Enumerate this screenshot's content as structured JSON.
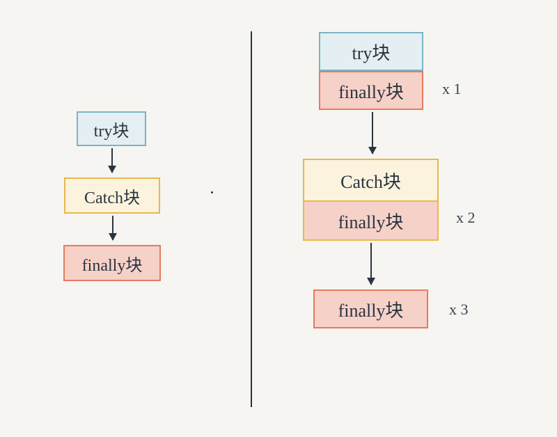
{
  "left": {
    "try_label": "try块",
    "catch_label": "Catch块",
    "finally_label": "finally块"
  },
  "right": {
    "group1": {
      "try_label": "try块",
      "finally_label": "finally块",
      "annotation": "x 1"
    },
    "group2": {
      "catch_label": "Catch块",
      "finally_label": "finally块",
      "annotation": "x 2"
    },
    "group3": {
      "finally_label": "finally块",
      "annotation": "x 3"
    }
  }
}
